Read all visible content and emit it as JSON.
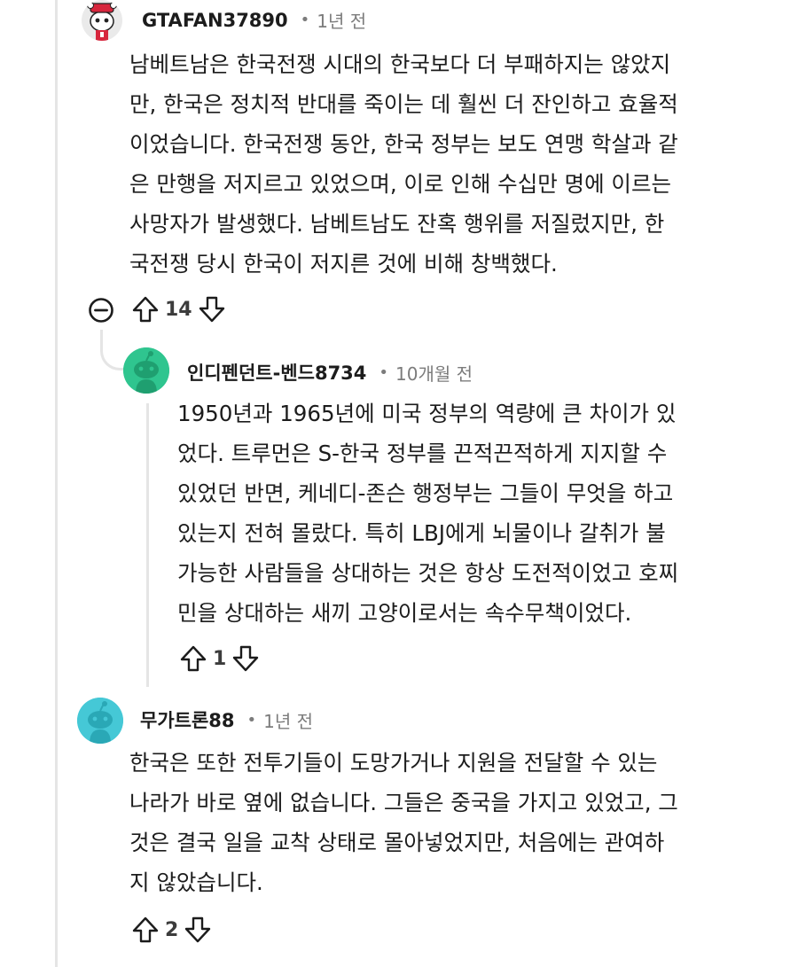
{
  "comments": [
    {
      "username": "GTAFAN37890",
      "dot": "•",
      "time": "1년 전",
      "lines": [
        "남베트남은 한국전쟁 시대의 한국보다 더 부패하지는 않았지",
        "만, 한국은 정치적 반대를 죽이는 데 훨씬 더 잔인하고 효율적",
        "이었습니다. 한국전쟁 동안, 한국 정부는 보도 연맹 학살과 같",
        "은 만행을 저지르고 있었으며, 이로 인해 수십만 명에 이르는",
        "사망자가 발생했다. 남베트남도 잔혹 행위를 저질렀지만, 한",
        "국전쟁 당시 한국이 저지른 것에 비해 창백했다."
      ],
      "votes": "14",
      "avatar_icon": "snoo-avatar-red-hat"
    },
    {
      "username": "인디펜던트-벤드8734",
      "dot": "•",
      "time": "10개월 전",
      "lines": [
        "1950년과 1965년에 미국 정부의 역량에 큰 차이가 있",
        "었다. 트루먼은 S-한국 정부를 끈적끈적하게 지지할 수",
        "있었던 반면, 케네디-존슨 행정부는 그들이 무엇을 하고",
        "있는지 전혀 몰랐다. 특히 LBJ에게 뇌물이나 갈취가 불",
        "가능한 사람들을 상대하는 것은 항상 도전적이었고 호찌",
        "민을 상대하는 새끼 고양이로서는 속수무책이었다."
      ],
      "votes": "1",
      "avatar_icon": "snoo-avatar-green"
    },
    {
      "username": "무가트론88",
      "dot": "•",
      "time": "1년 전",
      "lines": [
        "한국은 또한 전투기들이 도망가거나 지원을 전달할 수 있는",
        "나라가 바로 옆에 없습니다. 그들은 중국을 가지고 있었고, 그",
        "것은 결국 일을 교착 상태로 몰아넣었지만, 처음에는 관여하",
        "지 않았습니다."
      ],
      "votes": "2",
      "avatar_icon": "snoo-avatar-cyan"
    }
  ],
  "colors": {
    "thread_line": "#e5e5e5",
    "meta_text": "#7c7c7c",
    "green_avatar": "#2fc58f",
    "cyan_avatar": "#45c8d6"
  }
}
